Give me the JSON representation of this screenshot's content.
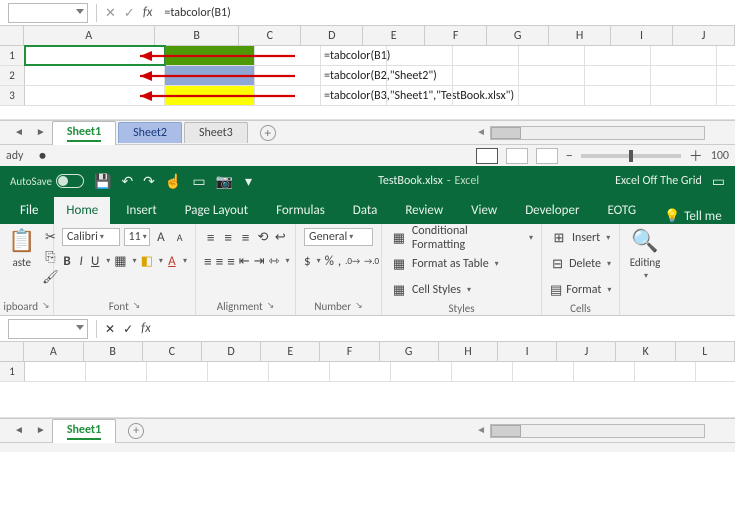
{
  "chart_data": {
    "type": "table",
    "formulas": [
      {
        "cell": "B1",
        "fill": "green",
        "formula": "=tabcolor(B1)"
      },
      {
        "cell": "B2",
        "fill": "blue",
        "formula": "=tabcolor(B2,\"Sheet2\")"
      },
      {
        "cell": "B3",
        "fill": "yellow",
        "formula": "=tabcolor(B3,\"Sheet1\",\"TestBook.xlsx\")"
      }
    ]
  },
  "top": {
    "formula": "=tabcolor(B1)",
    "columns_a": "A",
    "columns_b": "B",
    "columns_c": "C",
    "columns_d": "D",
    "columns_e": "E",
    "columns_f": "F",
    "columns_g": "G",
    "columns_h": "H",
    "columns_i": "I",
    "columns_j": "J",
    "r1": "1",
    "r2": "2",
    "r3": "3",
    "f1": "=tabcolor(B1)",
    "f2": "=tabcolor(B2,\"Sheet2\")",
    "f3": "=tabcolor(B3,\"Sheet1\",\"TestBook.xlsx\")",
    "sheet1": "Sheet1",
    "sheet2": "Sheet2",
    "sheet3": "Sheet3",
    "status": "ady",
    "zoom": "100"
  },
  "win2": {
    "autosave": "AutoSave",
    "title_file": "TestBook.xlsx",
    "title_app": "Excel",
    "title_right": "Excel Off The Grid",
    "tabs": {
      "file": "File",
      "home": "Home",
      "insert": "Insert",
      "page": "Page Layout",
      "formulas": "Formulas",
      "data": "Data",
      "review": "Review",
      "view": "View",
      "developer": "Developer",
      "eotg": "EOTG",
      "tellme": "Tell me"
    },
    "ribbon": {
      "clipboard": {
        "label": "ipboard",
        "paste": "aste"
      },
      "font": {
        "label": "Font",
        "name": "Calibri",
        "size": "11",
        "bold": "B",
        "italic": "I",
        "uline": "U"
      },
      "alignment": {
        "label": "Alignment"
      },
      "number": {
        "label": "Number",
        "general": "General"
      },
      "styles": {
        "label": "Styles",
        "cond": "Conditional Formatting",
        "table": "Format as Table",
        "cellstyles": "Cell Styles"
      },
      "cells": {
        "label": "Cells",
        "insert": "Insert",
        "delete": "Delete",
        "format": "Format"
      },
      "editing": {
        "label": "Editing"
      }
    },
    "grid": {
      "cA": "A",
      "cB": "B",
      "cC": "C",
      "cD": "D",
      "cE": "E",
      "cF": "F",
      "cG": "G",
      "cH": "H",
      "cI": "I",
      "cJ": "J",
      "cK": "K",
      "cL": "L",
      "r1": "1"
    },
    "sheet1": "Sheet1"
  },
  "glyph": {
    "fx": "fx",
    "check": "✓",
    "x": "✕",
    "caret": "▾",
    "plus": "⊕",
    "tri_l": "◄",
    "tri_r": "►",
    "minus": "−",
    "pluss": "＋",
    "save": "💾",
    "undo": "↶",
    "redo": "↷",
    "touch": "☝",
    "win": "▭",
    "cam": "📷",
    "find": "🔍",
    "bulb": "💡",
    "dash": " - ",
    "pct": "%",
    "comma": ",",
    "dec_inc": ".00→.0",
    "scissors": "✂",
    "brush": "🖌",
    "copy": "⎘",
    "border": "▦",
    "fill": "◧",
    "fontcolor": "A",
    "wrap": "↩",
    "merge": "⇿",
    "Asize": "A",
    "cond": "▦",
    "table": "▦",
    "cells": "▦",
    "ins": "⊞",
    "del": "⊟",
    "fmt": "▤",
    "launcher": "↘"
  }
}
